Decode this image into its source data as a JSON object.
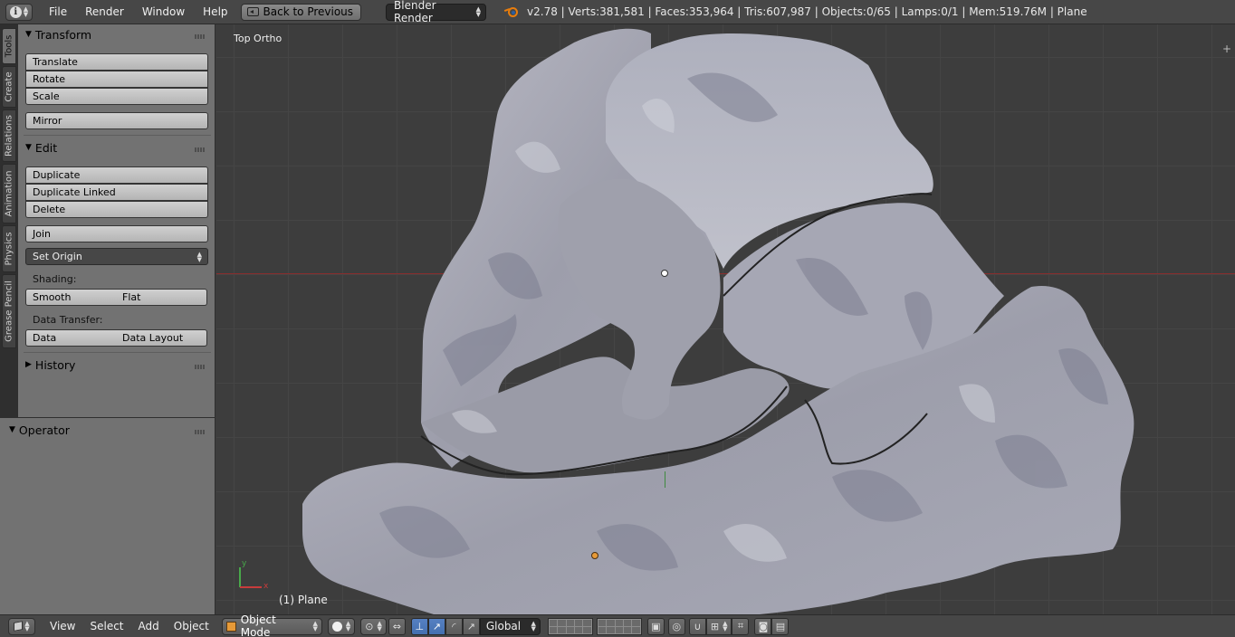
{
  "topbar": {
    "menus": [
      "File",
      "Render",
      "Window",
      "Help"
    ],
    "back_button": "Back to Previous",
    "render_engine": "Blender Render",
    "stats": "v2.78 | Verts:381,581 | Faces:353,964 | Tris:607,987 | Objects:0/65 | Lamps:0/1 | Mem:519.76M | Plane"
  },
  "tabs": [
    "Tools",
    "Create",
    "Relations",
    "Animation",
    "Physics",
    "Grease Pencil"
  ],
  "toolshelf": {
    "transform": {
      "title": "Transform",
      "buttons": [
        "Translate",
        "Rotate",
        "Scale",
        "Mirror"
      ]
    },
    "edit": {
      "title": "Edit",
      "buttons": [
        "Duplicate",
        "Duplicate Linked",
        "Delete",
        "Join"
      ],
      "set_origin": "Set Origin",
      "shading_label": "Shading:",
      "smooth": "Smooth",
      "flat": "Flat",
      "data_transfer_label": "Data Transfer:",
      "data": "Data",
      "data_layout": "Data Layout"
    },
    "history": {
      "title": "History"
    }
  },
  "operator": {
    "title": "Operator"
  },
  "viewport": {
    "view_name": "Top Ortho",
    "object_label": "(1) Plane",
    "axis_x": "x",
    "axis_y": "y"
  },
  "bottombar": {
    "menus": [
      "View",
      "Select",
      "Add",
      "Object"
    ],
    "mode": "Object Mode",
    "orientation": "Global"
  },
  "colors": {
    "accent_blue": "#5680c2",
    "origin_orange": "#e79a38",
    "x_axis_red": "#8a2d2d",
    "y_axis_green": "#3f8a3f"
  }
}
